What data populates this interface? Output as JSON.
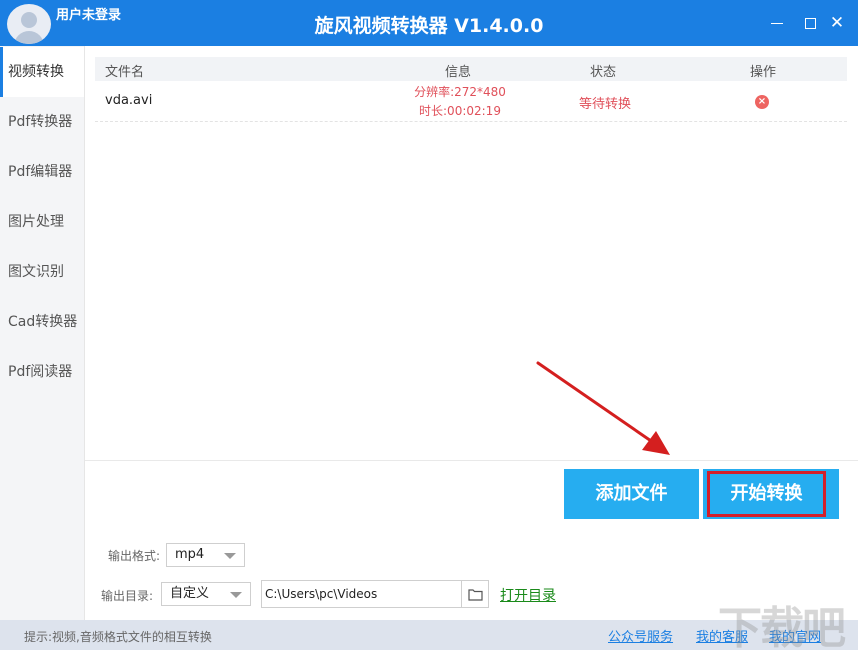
{
  "titlebar": {
    "user_label": "用户未登录",
    "app_title": "旋风视频转换器 V1.4.0.0",
    "close_glyph": "✕"
  },
  "sidebar": {
    "items": [
      {
        "label": "视频转换",
        "active": true
      },
      {
        "label": "Pdf转换器"
      },
      {
        "label": "Pdf编辑器"
      },
      {
        "label": "图片处理"
      },
      {
        "label": "图文识别"
      },
      {
        "label": "Cad转换器"
      },
      {
        "label": "Pdf阅读器"
      }
    ]
  },
  "table": {
    "columns": [
      "文件名",
      "信息",
      "状态",
      "操作"
    ],
    "rows": [
      {
        "filename": "vda.avi",
        "resolution": "分辨率:272*480",
        "duration": "时长:00:02:19",
        "status": "等待转换",
        "delete_glyph": "×"
      }
    ]
  },
  "actions": {
    "add_file": "添加文件",
    "start_convert": "开始转换"
  },
  "settings": {
    "format_label": "输出格式:",
    "format_value": "mp4",
    "dir_label": "输出目录:",
    "dir_value": "自定义",
    "path": "C:\\Users\\pc\\Videos",
    "open_dir": "打开目录"
  },
  "footer": {
    "tip": "提示:视频,音频格式文件的相互转换",
    "links": [
      "公众号服务",
      "我的客服",
      "我的官网"
    ]
  },
  "watermark": "下载吧",
  "colors": {
    "primary": "#1b7fe2",
    "button": "#26adf0",
    "highlight": "#d31f2b",
    "status_text": "#e0505a"
  }
}
